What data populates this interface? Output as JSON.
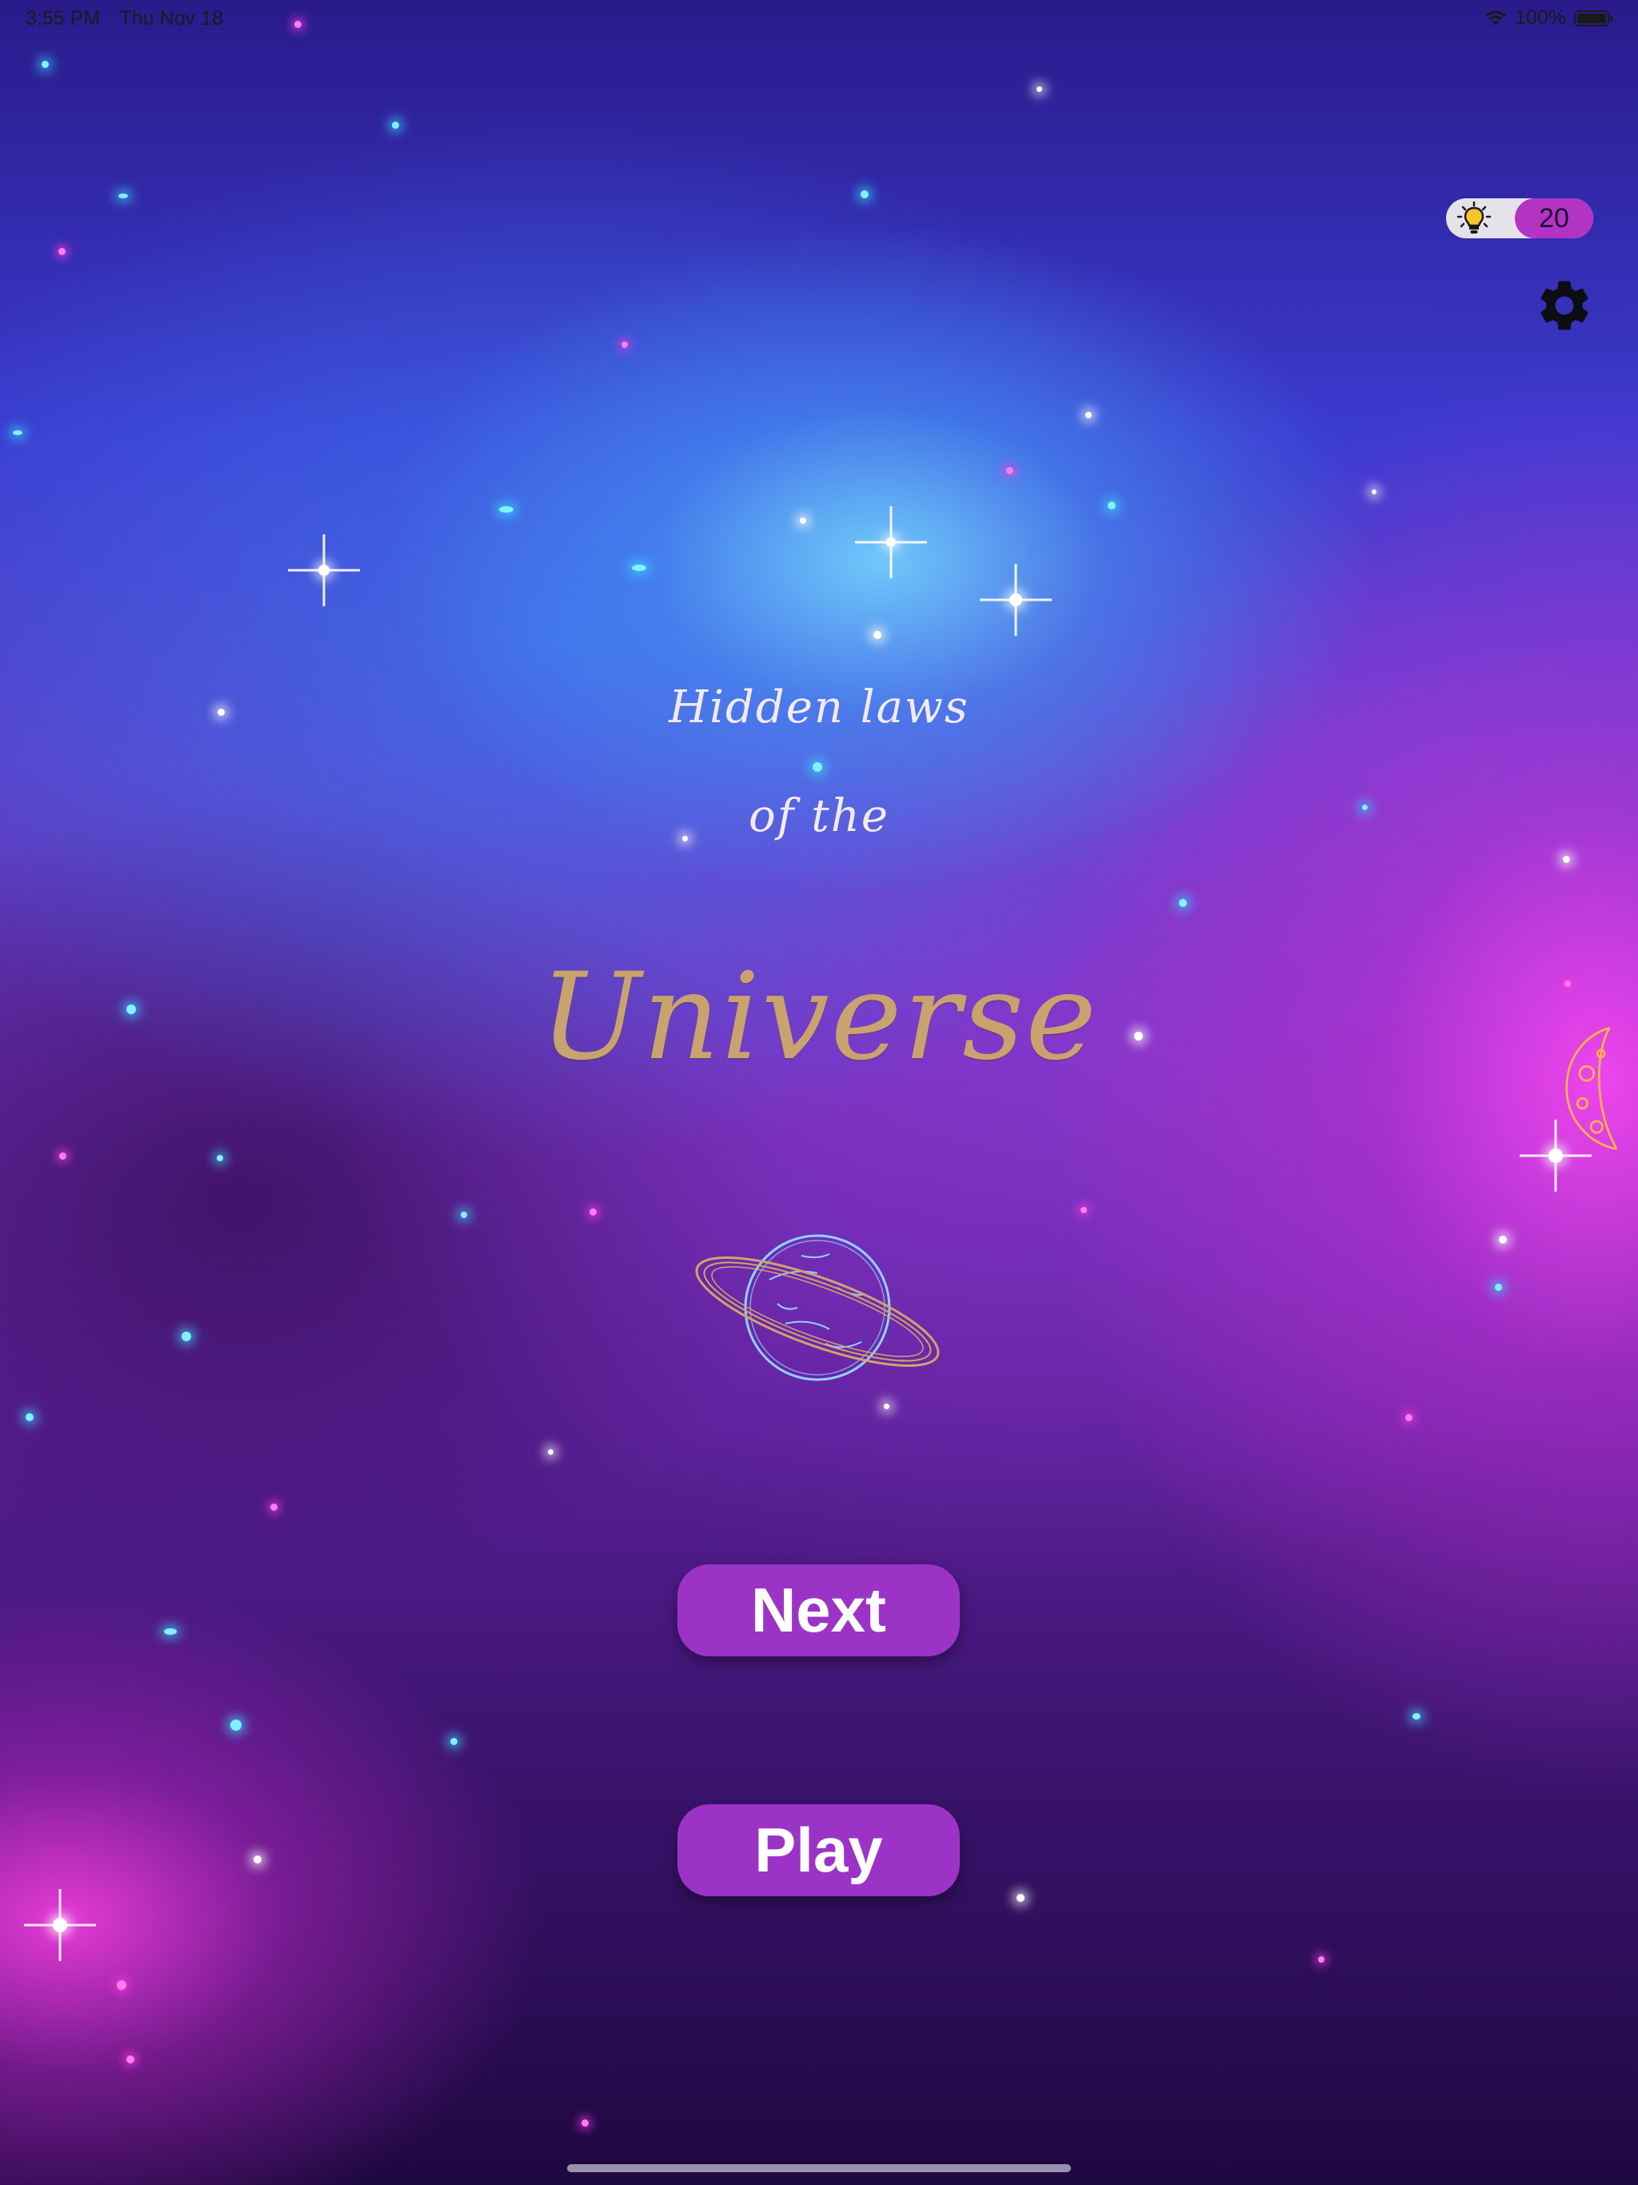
{
  "status_bar": {
    "time": "3:55 PM",
    "date": "Thu Nov 18",
    "battery_text": "100%",
    "icons": [
      "wifi-icon",
      "battery-icon"
    ]
  },
  "hints": {
    "count": "20",
    "icon": "lightbulb-icon",
    "accent_color": "#b233c4"
  },
  "settings": {
    "icon": "gear-icon"
  },
  "title": {
    "line1": "Hidden laws",
    "line2": "of the",
    "line3": "Universe",
    "title_color": "#f4eaf6",
    "universe_color": "#c9a36d"
  },
  "illustrations": [
    "saturn-planet-icon",
    "moon-icon"
  ],
  "buttons": {
    "next_label": "Next",
    "play_label": "Play",
    "color": "#9b34c6"
  }
}
